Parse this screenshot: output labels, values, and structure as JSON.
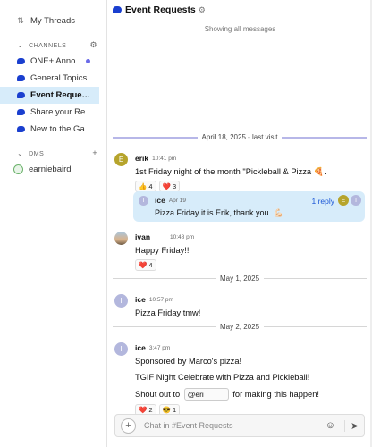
{
  "sidebar": {
    "my_threads": "My Threads",
    "channels_header": "CHANNELS",
    "channels": [
      {
        "label": "ONE+ Anno...",
        "unread": true,
        "active": false
      },
      {
        "label": "General Topics...",
        "unread": false,
        "active": false
      },
      {
        "label": "Event Requests",
        "unread": false,
        "active": true
      },
      {
        "label": "Share your Re...",
        "unread": false,
        "active": false
      },
      {
        "label": "New to the Ga...",
        "unread": false,
        "active": false
      }
    ],
    "dms_header": "DMS",
    "dms": [
      {
        "label": "earniebaird"
      }
    ]
  },
  "header": {
    "title": "Event Requests"
  },
  "status": {
    "showing": "Showing all messages"
  },
  "dividers": {
    "visit": "April 18, 2025 - last visit",
    "may1": "May 1, 2025",
    "may2": "May 2, 2025"
  },
  "messages": {
    "m1": {
      "avatar": "E",
      "user": "erik",
      "time": "10:41 pm",
      "text": "1st Friday night of the month \"Pickleball & Pizza 🍕.",
      "reactions": [
        "👍 4",
        "❤️ 3"
      ],
      "reply": {
        "avatar": "I",
        "user": "ice",
        "time": "Apr 19",
        "text": "Pizza Friday it is Erik, thank you. 💪🏻",
        "replies": "1 reply",
        "rav1": "E",
        "rav2": "I"
      }
    },
    "m2": {
      "user": "ivan",
      "time": "10:48 pm",
      "text": "Happy Friday!!",
      "reactions": [
        "❤️ 4"
      ]
    },
    "m3": {
      "avatar": "I",
      "user": "ice",
      "time": "10:57 pm",
      "text": "Pizza Friday tmw!"
    },
    "m4": {
      "avatar": "I",
      "user": "ice",
      "time": "3:47 pm",
      "line1": "Sponsored by Marco's pizza!",
      "line2": "TGIF Night Celebrate with Pizza and Pickleball!",
      "line3_pre": "Shout out to",
      "mention": "@eri",
      "line3_post": "for making this happen!",
      "reactions": [
        "❤️ 2",
        "😎 1"
      ]
    }
  },
  "composer": {
    "placeholder": "Chat in #Event Requests"
  },
  "colors": {
    "accent": "#1a3fcf",
    "active_bg": "#d7ecfa",
    "unread": "#6a6ae8",
    "link": "#1a56d6"
  }
}
